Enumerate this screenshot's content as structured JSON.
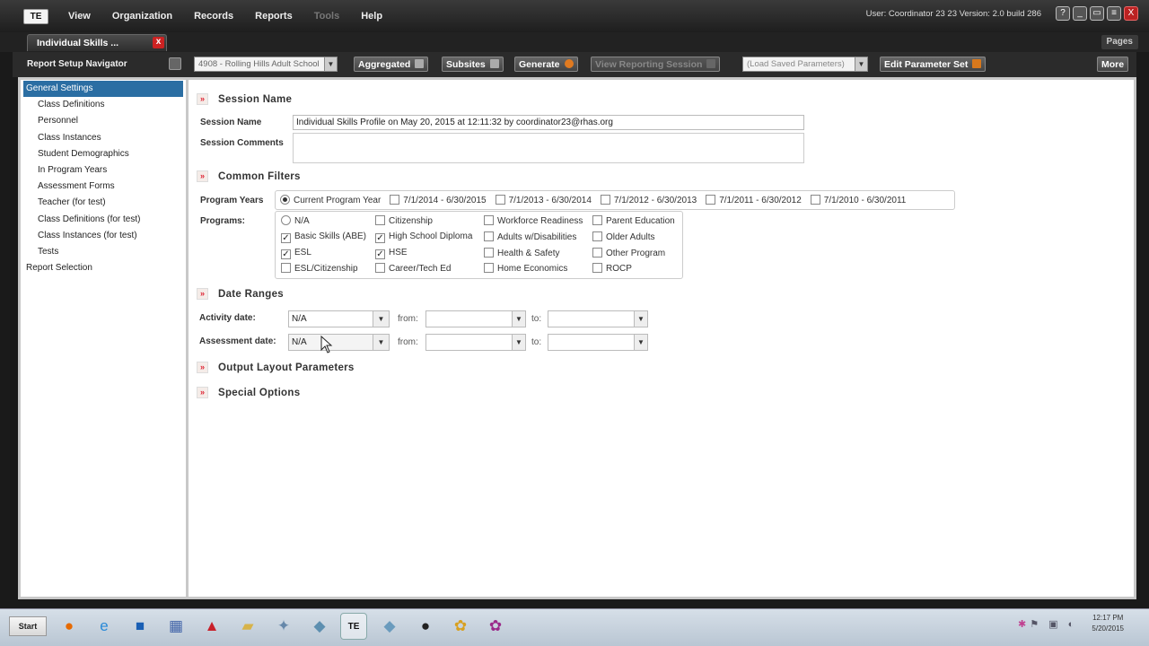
{
  "app": {
    "logo": "TE",
    "menu": [
      "View",
      "Organization",
      "Records",
      "Reports",
      "Tools",
      "Help"
    ],
    "user_info": "User: Coordinator 23 23   Version: 2.0 build 286",
    "window_buttons": [
      "?",
      "_",
      "▭",
      "≡",
      "X"
    ]
  },
  "tab": {
    "label": "Individual Skills ...",
    "close": "x",
    "pages_label": "Pages"
  },
  "toolbar": {
    "nav_title": "Report Setup Navigator",
    "site_select": "4908 - Rolling Hills Adult School",
    "aggregated_label": "Aggregated",
    "subsites_label": "Subsites",
    "generate_label": "Generate",
    "view_session_label": "View Reporting Session",
    "load_saved_placeholder": "(Load Saved Parameters)",
    "edit_param_label": "Edit Parameter Set",
    "more_label": "More"
  },
  "navigator": {
    "items": [
      {
        "label": "General Settings",
        "level": "top",
        "selected": true
      },
      {
        "label": "Class Definitions",
        "level": "sub"
      },
      {
        "label": "Personnel",
        "level": "sub"
      },
      {
        "label": "Class Instances",
        "level": "sub"
      },
      {
        "label": "Student Demographics",
        "level": "sub"
      },
      {
        "label": "In Program Years",
        "level": "sub"
      },
      {
        "label": "Assessment Forms",
        "level": "sub"
      },
      {
        "label": "Teacher (for test)",
        "level": "sub"
      },
      {
        "label": "Class Definitions (for test)",
        "level": "sub"
      },
      {
        "label": "Class Instances (for test)",
        "level": "sub"
      },
      {
        "label": "Tests",
        "level": "sub"
      },
      {
        "label": "Report Selection",
        "level": "top"
      }
    ]
  },
  "session": {
    "heading": "Session Name",
    "name_label": "Session Name",
    "name_value": "Individual Skills Profile on May 20, 2015 at 12:11:32 by coordinator23@rhas.org",
    "comments_label": "Session Comments"
  },
  "filters": {
    "heading": "Common Filters",
    "program_years_label": "Program Years",
    "program_years": [
      {
        "label": "Current Program Year",
        "type": "radio",
        "checked": true
      },
      {
        "label": "7/1/2014 - 6/30/2015",
        "type": "checkbox",
        "checked": false
      },
      {
        "label": "7/1/2013 - 6/30/2014",
        "type": "checkbox",
        "checked": false
      },
      {
        "label": "7/1/2012 - 6/30/2013",
        "type": "checkbox",
        "checked": false
      },
      {
        "label": "7/1/2011 - 6/30/2012",
        "type": "checkbox",
        "checked": false
      },
      {
        "label": "7/1/2010 - 6/30/2011",
        "type": "checkbox",
        "checked": false
      }
    ],
    "programs_label": "Programs:",
    "programs": [
      {
        "label": "N/A",
        "type": "radio",
        "checked": false
      },
      {
        "label": "Basic Skills (ABE)",
        "type": "checkbox",
        "checked": true
      },
      {
        "label": "ESL",
        "type": "checkbox",
        "checked": true
      },
      {
        "label": "ESL/Citizenship",
        "type": "checkbox",
        "checked": false
      },
      {
        "label": "Citizenship",
        "type": "checkbox",
        "checked": false
      },
      {
        "label": "High School Diploma",
        "type": "checkbox",
        "checked": true
      },
      {
        "label": "HSE",
        "type": "checkbox",
        "checked": true
      },
      {
        "label": "Career/Tech Ed",
        "type": "checkbox",
        "checked": false
      },
      {
        "label": "Workforce Readiness",
        "type": "checkbox",
        "checked": false
      },
      {
        "label": "Adults w/Disabilities",
        "type": "checkbox",
        "checked": false
      },
      {
        "label": "Health & Safety",
        "type": "checkbox",
        "checked": false
      },
      {
        "label": "Home Economics",
        "type": "checkbox",
        "checked": false
      },
      {
        "label": "Parent Education",
        "type": "checkbox",
        "checked": false
      },
      {
        "label": "Older Adults",
        "type": "checkbox",
        "checked": false
      },
      {
        "label": "Other Program",
        "type": "checkbox",
        "checked": false
      },
      {
        "label": "ROCP",
        "type": "checkbox",
        "checked": false
      }
    ]
  },
  "dates": {
    "heading": "Date Ranges",
    "activity_label": "Activity date:",
    "activity_value": "N/A",
    "assessment_label": "Assessment date:",
    "assessment_value": "N/A",
    "from_label": "from:",
    "to_label": "to:"
  },
  "sections": {
    "output_layout": "Output Layout Parameters",
    "special_options": "Special Options"
  },
  "taskbar": {
    "start_label": "Start",
    "clock_time": "12:17 PM",
    "clock_date": "5/20/2015",
    "te_label": "TE"
  }
}
